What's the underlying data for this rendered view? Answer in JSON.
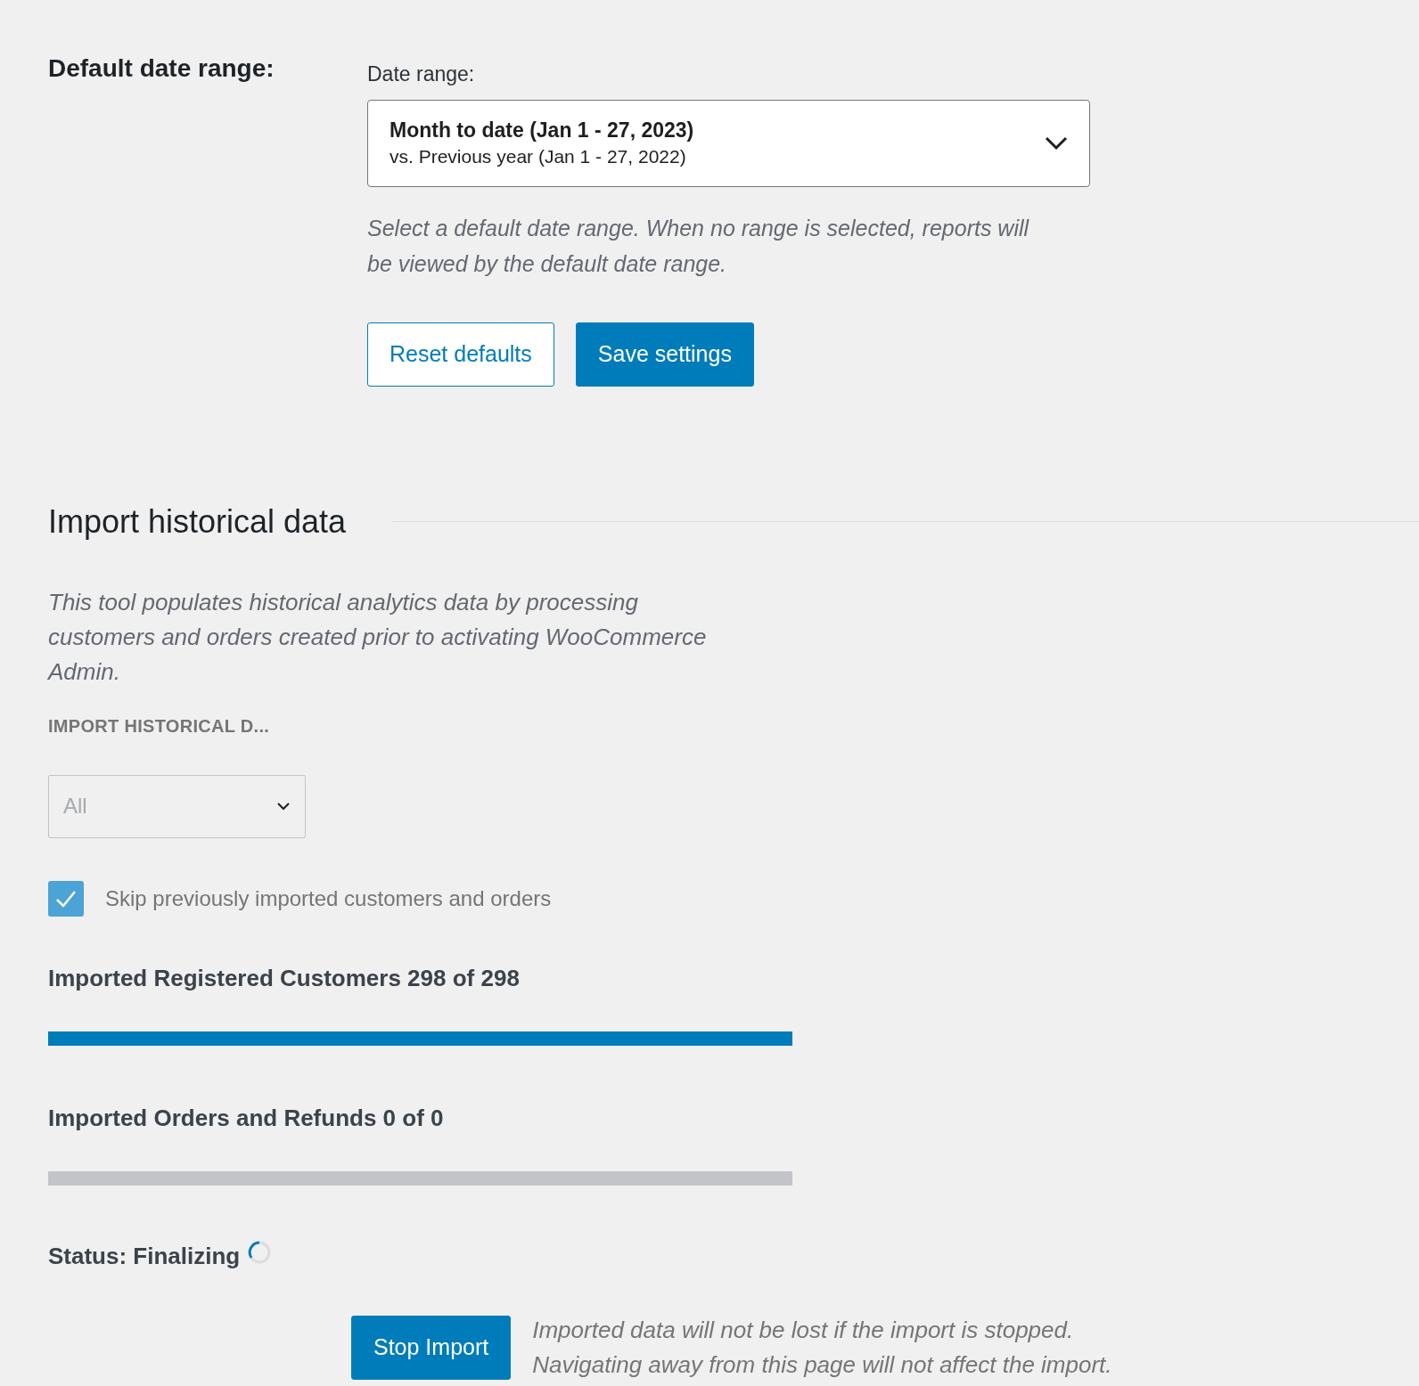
{
  "date_settings": {
    "heading": "Default date range:",
    "field_label": "Date range:",
    "date_range": {
      "primary": "Month to date (Jan 1 - 27, 2023)",
      "secondary": "vs. Previous year (Jan 1 - 27, 2022)"
    },
    "help_lines": [
      "Select a default date range. When no range is selected, reports will",
      "be viewed by the default date range."
    ],
    "buttons": [
      {
        "label": "Reset defaults",
        "kind": "secondary"
      },
      {
        "label": "Save settings",
        "kind": "primary"
      }
    ]
  },
  "import": {
    "title": "Import historical data",
    "description_lines": [
      "This tool populates historical analytics data by processing",
      "customers and orders created prior to activating WooCommerce",
      "Admin."
    ],
    "select_label": "IMPORT HISTORICAL D...",
    "select": {
      "value": "All"
    },
    "skip_checkbox": {
      "label": "Skip previously imported customers and orders",
      "checked": true
    },
    "progress": [
      {
        "label": "Imported Registered Customers 298 of 298",
        "level": 1
      },
      {
        "label": "Imported Orders and Refunds 0 of 0",
        "level": 0
      }
    ],
    "status": {
      "label": "Status: Finalizing",
      "busy": true
    },
    "stop_button": {
      "label": "Stop Import"
    },
    "note_lines": [
      "Imported data will not be lost if the import is stopped.",
      "Navigating away from this page will not affect the import."
    ]
  }
}
